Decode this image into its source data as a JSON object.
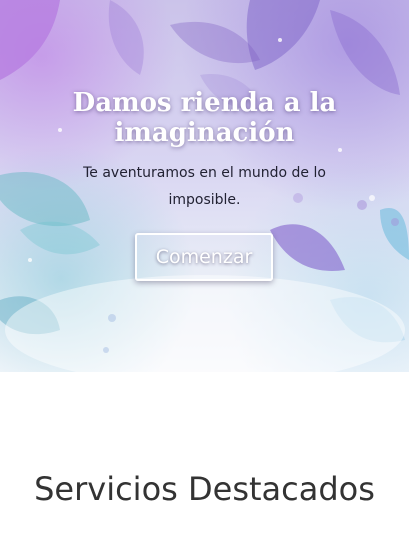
{
  "hero": {
    "title_line1": "Damos rienda a la",
    "title_line2": "imaginación",
    "subtitle_line1": "Te aventuramos en el mundo de lo",
    "subtitle_line2": "imposible.",
    "cta_label": "Comenzar"
  },
  "services": {
    "title": "Servicios Destacados"
  },
  "colors": {
    "title_text": "#ffffff",
    "subtitle_text": "#222233",
    "section_title": "#333333"
  }
}
